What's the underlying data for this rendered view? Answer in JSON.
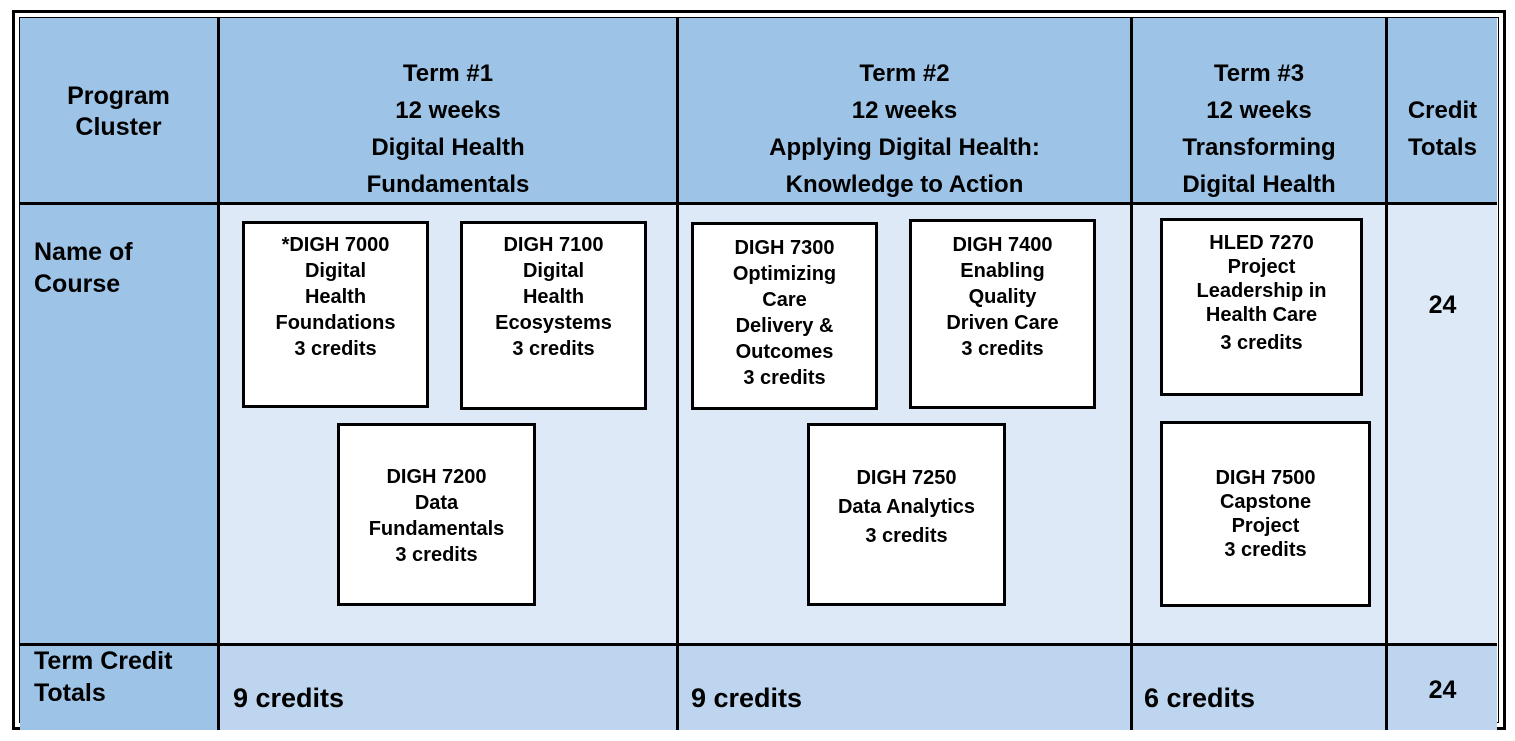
{
  "header": {
    "program_cluster": [
      "Program",
      "Cluster"
    ],
    "terms": [
      {
        "lines": [
          "Term #1",
          "12 weeks",
          "Digital Health",
          "Fundamentals"
        ]
      },
      {
        "lines": [
          "Term #2",
          "12 weeks",
          "Applying Digital Health:",
          "Knowledge to Action"
        ]
      },
      {
        "lines": [
          "Term #3",
          "12 weeks",
          "Transforming",
          "Digital Health"
        ]
      }
    ],
    "credit_totals": [
      "Credit",
      "Totals"
    ]
  },
  "rows": {
    "name_of_course_label": [
      "Name of",
      "Course"
    ],
    "term_credit_totals_label": [
      "Term Credit",
      "Totals"
    ]
  },
  "courses": {
    "term1": [
      {
        "code": "*DIGH 7000",
        "title": [
          "Digital",
          "Health",
          "Foundations"
        ],
        "credits": "3 credits"
      },
      {
        "code": "DIGH 7100",
        "title": [
          "Digital",
          "Health",
          "Ecosystems"
        ],
        "credits": "3 credits"
      },
      {
        "code": "DIGH 7200",
        "title": [
          "Data",
          "Fundamentals"
        ],
        "credits": "3 credits"
      }
    ],
    "term2": [
      {
        "code": "DIGH 7300",
        "title": [
          "Optimizing",
          "Care",
          "Delivery &",
          "Outcomes"
        ],
        "credits": "3 credits"
      },
      {
        "code": "DIGH 7400",
        "title": [
          "Enabling",
          "Quality",
          "Driven Care"
        ],
        "credits": "3 credits"
      },
      {
        "code": "DIGH 7250",
        "title": [
          "Data Analytics"
        ],
        "credits": "3 credits"
      }
    ],
    "term3": [
      {
        "code": "HLED 7270",
        "title": [
          "Project",
          "Leadership in",
          "Health Care"
        ],
        "credits": "3 credits"
      },
      {
        "code": "DIGH 7500",
        "title": [
          "Capstone",
          "Project"
        ],
        "credits": "3 credits"
      }
    ]
  },
  "course_credit_total": "24",
  "term_totals": [
    "9 credits",
    "9 credits",
    "6 credits"
  ],
  "grand_total": "24",
  "colors": {
    "header_blue": "#9dc3e6",
    "body_light_blue": "#dde9f6",
    "totals_blue": "#bdd5ee"
  }
}
